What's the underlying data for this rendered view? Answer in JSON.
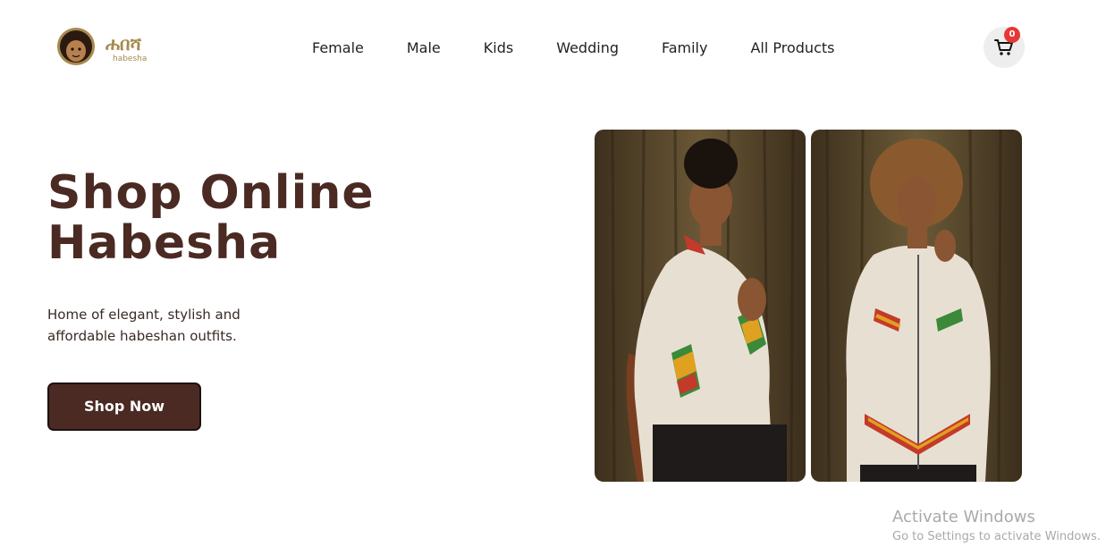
{
  "brand": {
    "logo_script": "ሐበሻ",
    "logo_text": "habesha",
    "colors": {
      "primary": "#4a2a22",
      "logo_gold": "#a8894e",
      "badge": "#e53935"
    }
  },
  "nav": {
    "items": [
      {
        "label": "Female"
      },
      {
        "label": "Male"
      },
      {
        "label": "Kids"
      },
      {
        "label": "Wedding"
      },
      {
        "label": "Family"
      },
      {
        "label": "All Products"
      }
    ]
  },
  "cart": {
    "icon": "shopping-cart-icon",
    "count": "0"
  },
  "hero": {
    "title_line1": "Shop Online",
    "title_line2": "Habesha",
    "subtitle": "Home of elegant, stylish and affordable habeshan outfits.",
    "cta_label": "Shop Now",
    "images": [
      {
        "name": "male-model-photo",
        "subject": "man in cream jacket with kente trim"
      },
      {
        "name": "female-model-photo",
        "subject": "woman in cream jacket with kente trim"
      }
    ]
  },
  "watermark": {
    "title": "Activate Windows",
    "subtitle": "Go to Settings to activate Windows."
  }
}
